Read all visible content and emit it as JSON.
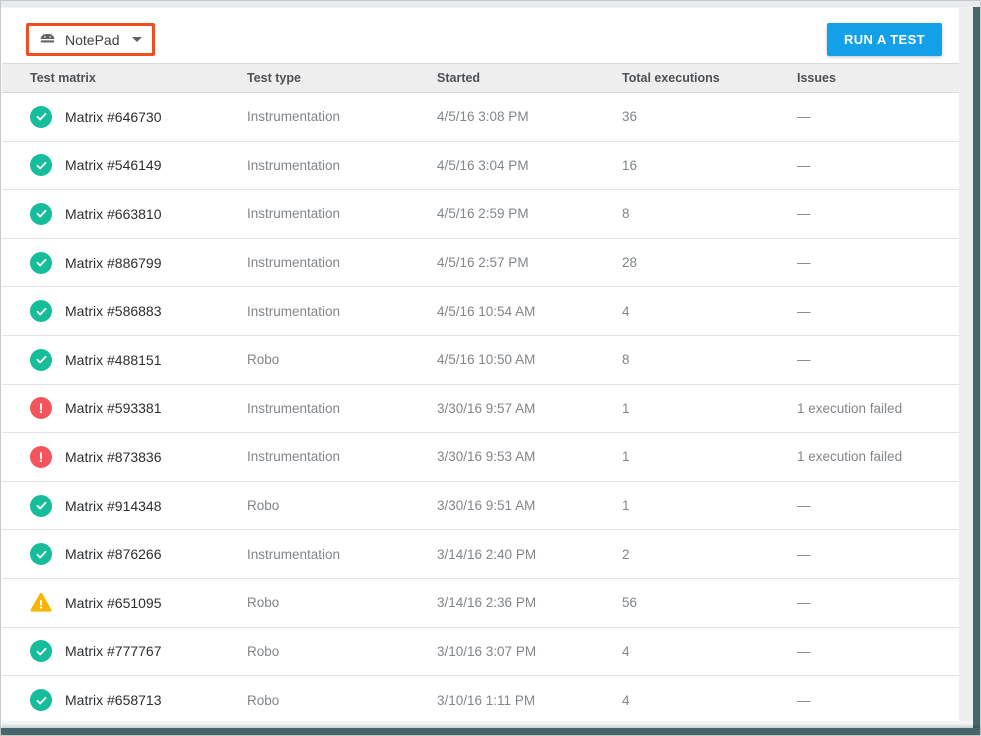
{
  "toolbar": {
    "app_selector": {
      "label": "NotePad",
      "icon": "android-icon",
      "dropdown_icon": "caret-down-icon"
    },
    "run_test_label": "RUN A TEST"
  },
  "table": {
    "columns": [
      "Test matrix",
      "Test type",
      "Started",
      "Total executions",
      "Issues"
    ],
    "rows": [
      {
        "status": "success",
        "matrix": "Matrix #646730",
        "type": "Instrumentation",
        "started": "4/5/16 3:08 PM",
        "executions": "36",
        "issues": "—"
      },
      {
        "status": "success",
        "matrix": "Matrix #546149",
        "type": "Instrumentation",
        "started": "4/5/16 3:04 PM",
        "executions": "16",
        "issues": "—"
      },
      {
        "status": "success",
        "matrix": "Matrix #663810",
        "type": "Instrumentation",
        "started": "4/5/16 2:59 PM",
        "executions": "8",
        "issues": "—"
      },
      {
        "status": "success",
        "matrix": "Matrix #886799",
        "type": "Instrumentation",
        "started": "4/5/16 2:57 PM",
        "executions": "28",
        "issues": "—"
      },
      {
        "status": "success",
        "matrix": "Matrix #586883",
        "type": "Instrumentation",
        "started": "4/5/16 10:54 AM",
        "executions": "4",
        "issues": "—"
      },
      {
        "status": "success",
        "matrix": "Matrix #488151",
        "type": "Robo",
        "started": "4/5/16 10:50 AM",
        "executions": "8",
        "issues": "—"
      },
      {
        "status": "error",
        "matrix": "Matrix #593381",
        "type": "Instrumentation",
        "started": "3/30/16 9:57 AM",
        "executions": "1",
        "issues": "1 execution failed"
      },
      {
        "status": "error",
        "matrix": "Matrix #873836",
        "type": "Instrumentation",
        "started": "3/30/16 9:53 AM",
        "executions": "1",
        "issues": "1 execution failed"
      },
      {
        "status": "success",
        "matrix": "Matrix #914348",
        "type": "Robo",
        "started": "3/30/16 9:51 AM",
        "executions": "1",
        "issues": "—"
      },
      {
        "status": "success",
        "matrix": "Matrix #876266",
        "type": "Instrumentation",
        "started": "3/14/16 2:40 PM",
        "executions": "2",
        "issues": "—"
      },
      {
        "status": "warning",
        "matrix": "Matrix #651095",
        "type": "Robo",
        "started": "3/14/16 2:36 PM",
        "executions": "56",
        "issues": "—"
      },
      {
        "status": "success",
        "matrix": "Matrix #777767",
        "type": "Robo",
        "started": "3/10/16 3:07 PM",
        "executions": "4",
        "issues": "—"
      },
      {
        "status": "success",
        "matrix": "Matrix #658713",
        "type": "Robo",
        "started": "3/10/16 1:11 PM",
        "executions": "4",
        "issues": "—"
      }
    ],
    "status_icons": {
      "success": "check-circle-icon",
      "error": "error-circle-icon",
      "warning": "warning-triangle-icon"
    }
  },
  "colors": {
    "accent_blue": "#12a0e8",
    "success_green": "#15bd9b",
    "error_red": "#f4545c",
    "warning_amber": "#f7b500",
    "highlight_orange": "#f04e23",
    "frame_teal": "#47666b"
  }
}
